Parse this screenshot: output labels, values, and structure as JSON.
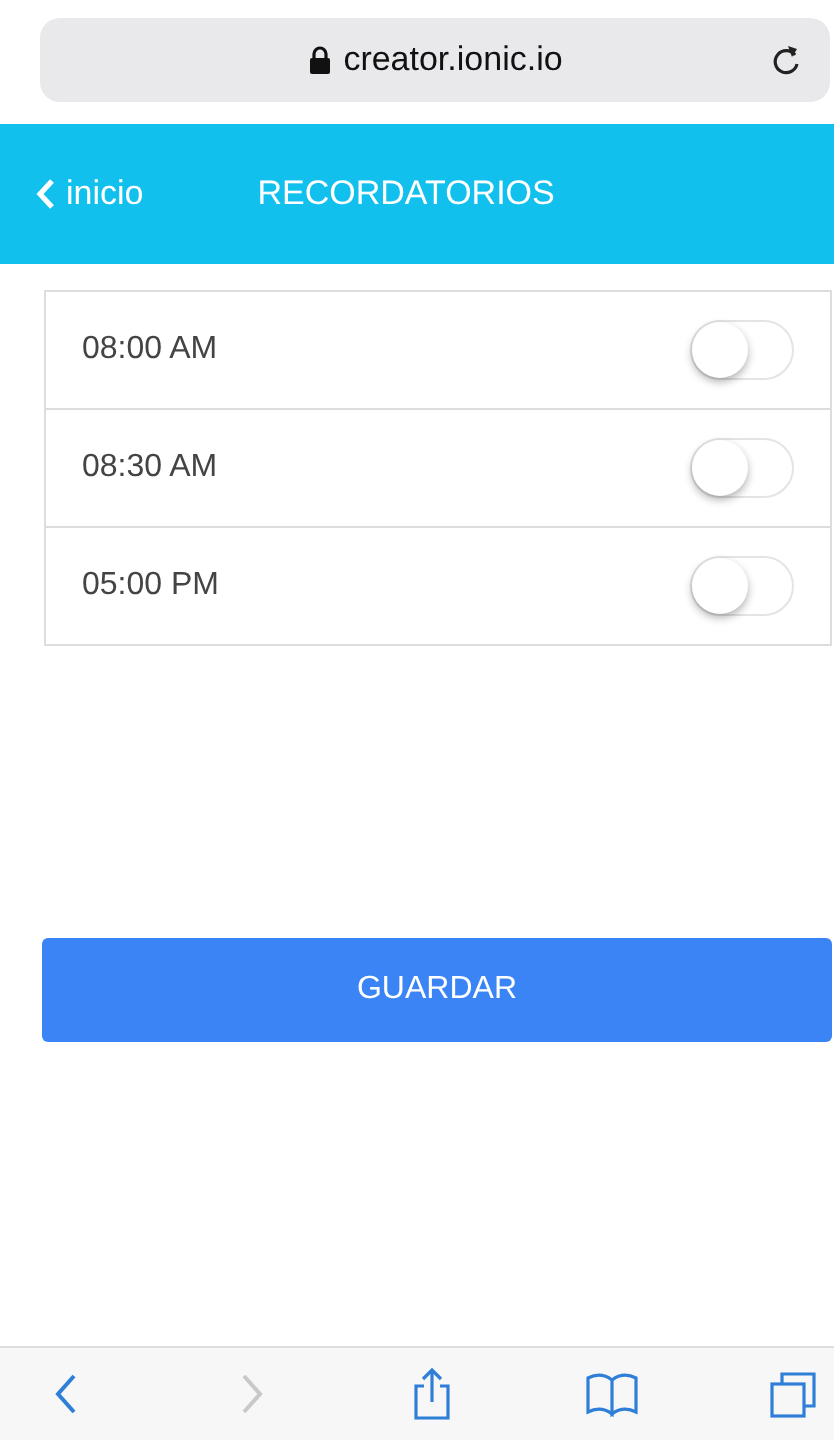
{
  "browser": {
    "url": "creator.ionic.io"
  },
  "header": {
    "back_label": "inicio",
    "title": "RECORDATORIOS"
  },
  "reminders": [
    {
      "time": "08:00 AM",
      "on": false
    },
    {
      "time": "08:30 AM",
      "on": false
    },
    {
      "time": "05:00 PM",
      "on": false
    }
  ],
  "save_button": "GUARDAR",
  "toolbar": [
    {
      "kind": "back",
      "disabled": false
    },
    {
      "kind": "forward",
      "disabled": true
    },
    {
      "kind": "share",
      "disabled": false
    },
    {
      "kind": "bookmarks",
      "disabled": false
    },
    {
      "kind": "tabs",
      "disabled": false
    }
  ]
}
